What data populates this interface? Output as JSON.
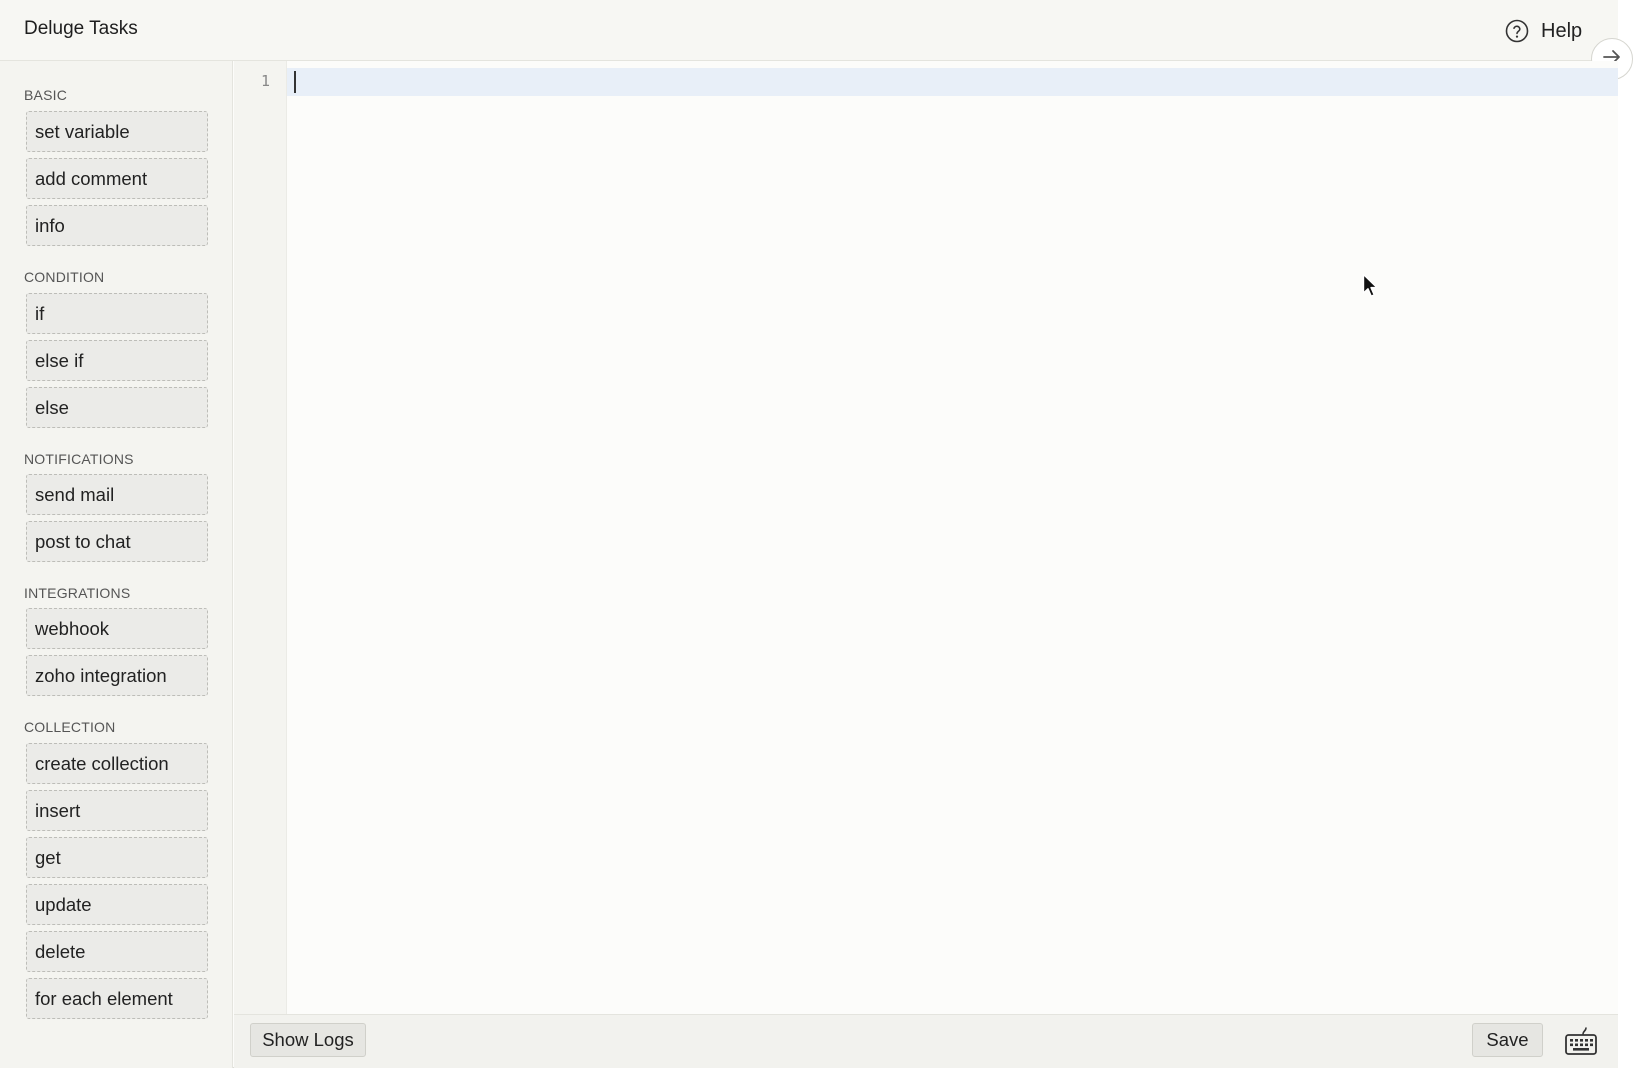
{
  "header": {
    "title": "Deluge Tasks",
    "help_label": "Help"
  },
  "sidebar": {
    "sections": [
      {
        "label": "BASIC",
        "items": [
          "set variable",
          "add comment",
          "info"
        ]
      },
      {
        "label": "CONDITION",
        "items": [
          "if",
          "else if",
          "else"
        ]
      },
      {
        "label": "NOTIFICATIONS",
        "items": [
          "send mail",
          "post to chat"
        ]
      },
      {
        "label": "INTEGRATIONS",
        "items": [
          "webhook",
          "zoho integration"
        ]
      },
      {
        "label": "COLLECTION",
        "items": [
          "create collection",
          "insert",
          "get",
          "update",
          "delete",
          "for each element"
        ]
      }
    ]
  },
  "editor": {
    "line_numbers": [
      "1"
    ],
    "content": ""
  },
  "footer": {
    "show_logs_label": "Show Logs",
    "save_label": "Save"
  },
  "icons": {
    "help": "question-circle-icon",
    "collapse": "arrow-right-icon",
    "keyboard": "keyboard-icon",
    "mouse": "mouse-pointer-icon"
  },
  "colors": {
    "active_line": "#e8eff8",
    "task_background": "#ebebe8",
    "sidebar_background": "#f4f4f0"
  }
}
